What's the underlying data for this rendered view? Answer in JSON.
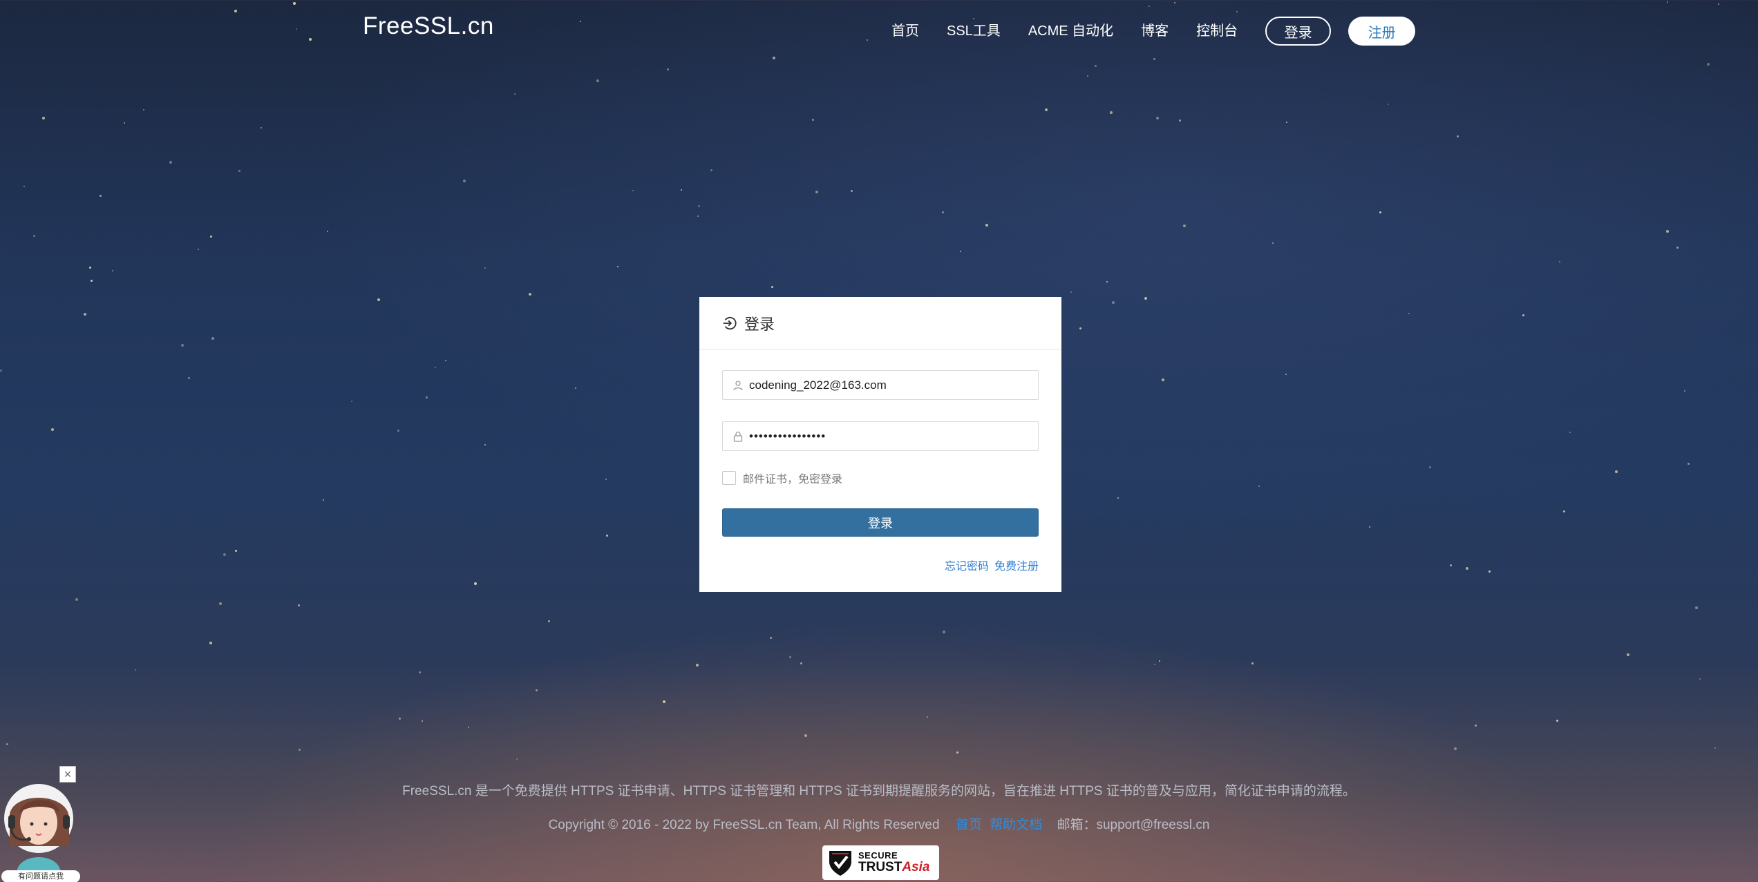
{
  "header": {
    "logo": "FreeSSL.cn",
    "nav": [
      {
        "label": "首页"
      },
      {
        "label": "SSL工具"
      },
      {
        "label": "ACME 自动化"
      },
      {
        "label": "博客"
      },
      {
        "label": "控制台"
      }
    ],
    "login_button": "登录",
    "register_button": "注册"
  },
  "login_card": {
    "title": "登录",
    "title_icon": "login-icon",
    "email_value": "codening_2022@163.com",
    "email_icon": "user-icon",
    "password_value": "••••••••••••••••",
    "password_icon": "lock-icon",
    "remember_label": "邮件证书，免密登录",
    "remember_checked": false,
    "submit_label": "登录",
    "forgot_password": "忘记密码",
    "free_register": "免费注册"
  },
  "footer": {
    "description": "FreeSSL.cn 是一个免费提供 HTTPS 证书申请、HTTPS 证书管理和 HTTPS 证书到期提醒服务的网站，旨在推进 HTTPS 证书的普及与应用，简化证书申请的流程。",
    "copyright": "Copyright © 2016 - 2022 by FreeSSL.cn Team, All Rights Reserved",
    "home_link": "首页",
    "help_link": "帮助文档",
    "email": "邮箱：support@freessl.cn",
    "badge_line1": "SECURE",
    "badge_line2_a": "TRUST",
    "badge_line2_b": "Asia"
  },
  "support_widget": {
    "label": "有问题请点我",
    "close": "×"
  },
  "colors": {
    "primary_button": "#33709f",
    "link": "#2e7dd1",
    "register_text": "#2a7ab8"
  }
}
